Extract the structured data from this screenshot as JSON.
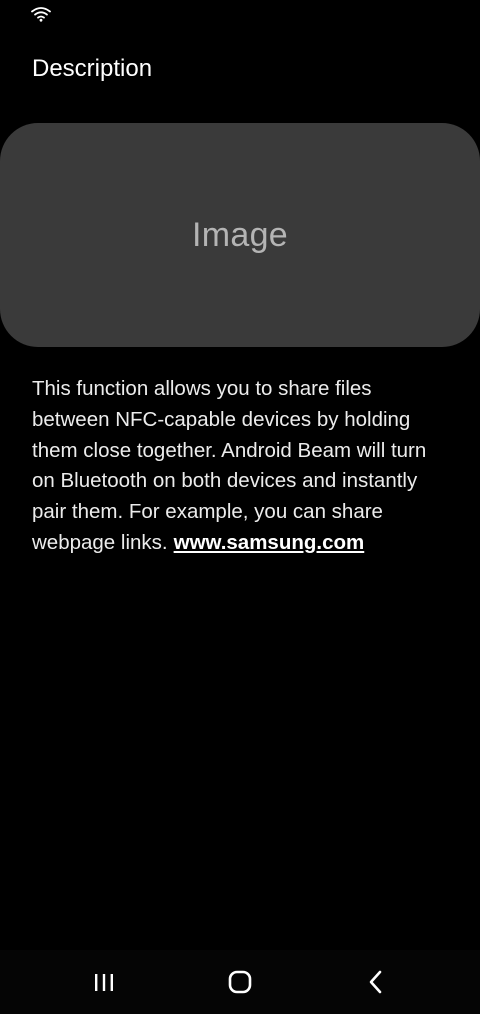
{
  "status_bar": {
    "wifi_icon": "wifi-icon"
  },
  "page": {
    "title": "Description"
  },
  "image_card": {
    "placeholder": "Image"
  },
  "description": {
    "text": "This function allows you to share files between NFC-capable devices by holding them close together. Android Beam will turn on Bluetooth on both devices and instantly pair them. For example, you can share webpage links.",
    "link_text": "www.samsung.com"
  },
  "nav_bar": {
    "recents_icon": "recents-icon",
    "home_icon": "home-icon",
    "back_icon": "back-icon"
  },
  "colors": {
    "background": "#000000",
    "card": "#3a3a3a",
    "text": "#ececec",
    "placeholder_text": "#b4b4b4"
  }
}
